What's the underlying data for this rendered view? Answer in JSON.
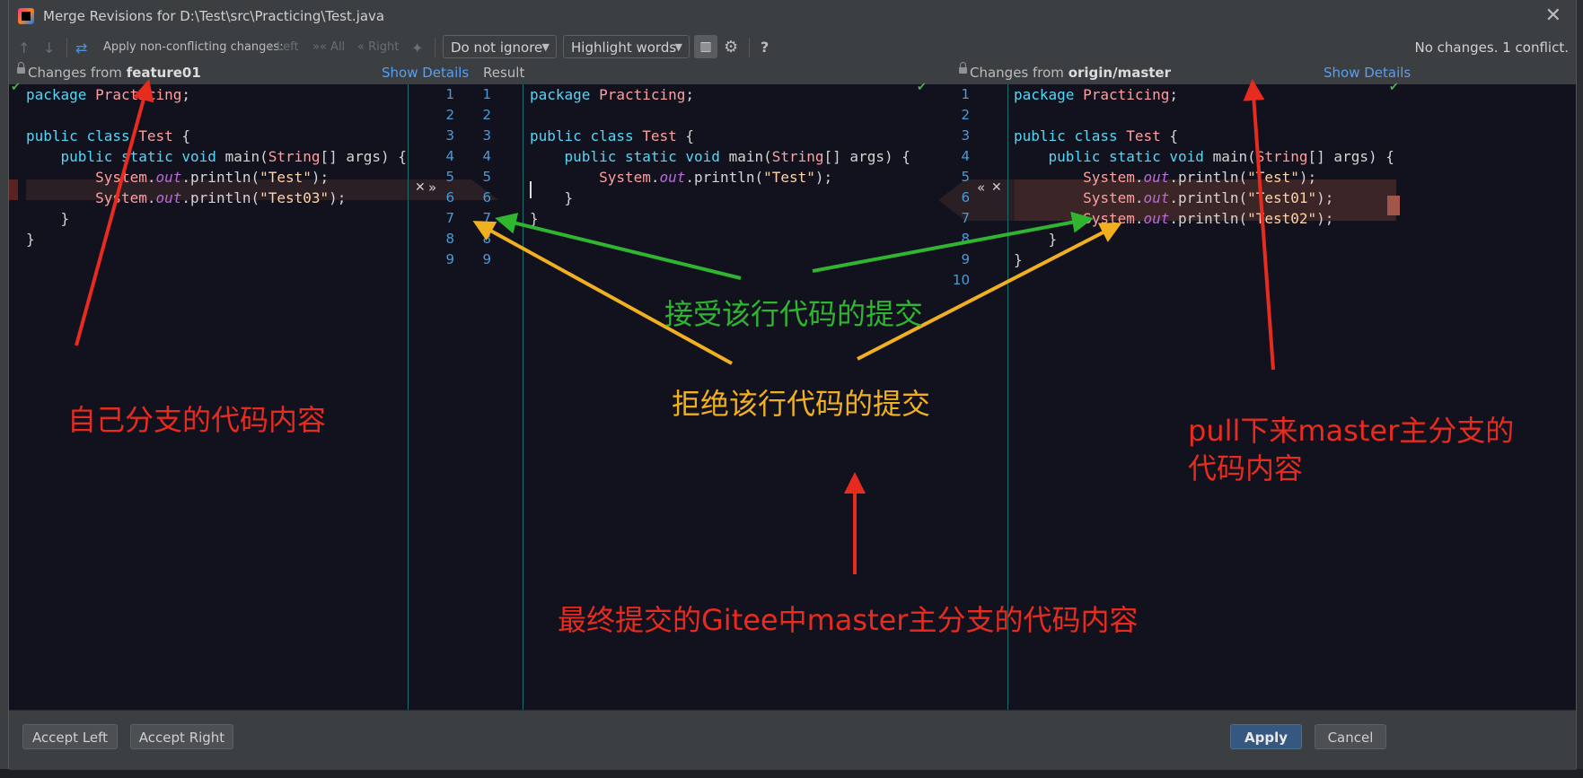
{
  "window": {
    "title": "Merge Revisions for D:\\Test\\src\\Practicing\\Test.java"
  },
  "toolbar": {
    "apply_label": "Apply non-conflicting changes:",
    "left": "Left",
    "all": "All",
    "right": "Right",
    "ignore_combo": "Do not ignore",
    "highlight_combo": "Highlight words",
    "help": "?",
    "status": "No changes. 1 conflict."
  },
  "header": {
    "left_prefix": "Changes from ",
    "left_branch": "feature01",
    "left_link": "Show Details",
    "result": "Result",
    "right_prefix": "Changes from ",
    "right_branch": "origin/master",
    "right_link": "Show Details"
  },
  "left_code": [
    "package Practicing;",
    "",
    "public class Test {",
    "    public static void main(String[] args) {",
    "        System.out.println(\"Test\");",
    "        System.out.println(\"Test03\");",
    "    }",
    "}",
    ""
  ],
  "result_code": [
    "package Practicing;",
    "",
    "public class Test {",
    "    public static void main(String[] args) {",
    "        System.out.println(\"Test\");",
    "    }",
    "}"
  ],
  "right_code": [
    "package Practicing;",
    "",
    "public class Test {",
    "    public static void main(String[] args) {",
    "        System.out.println(\"Test\");",
    "        System.out.println(\"Test01\");",
    "        System.out.println(\"Test02\");",
    "    }",
    "}",
    ""
  ],
  "gutters": {
    "left_numbers": [
      "1",
      "2",
      "3",
      "4",
      "5",
      "6",
      "7",
      "8",
      "9"
    ],
    "result_numbers": [
      "1",
      "2",
      "3",
      "4",
      "5",
      "6",
      "7",
      "8",
      "9"
    ],
    "right_numbers": [
      "1",
      "2",
      "3",
      "4",
      "5",
      "6",
      "7",
      "8",
      "9",
      "10"
    ]
  },
  "buttons": {
    "accept_left": "Accept Left",
    "accept_right": "Accept Right",
    "apply": "Apply",
    "cancel": "Cancel"
  },
  "annotations": {
    "own_branch": "自己分支的代码内容",
    "accept_line": "接受该行代码的提交",
    "reject_line": "拒绝该行代码的提交",
    "pulled_master_1": "pull下来master主分支的",
    "pulled_master_2": "代码内容",
    "final_commit": "最终提交的Gitee中master主分支的代码内容"
  },
  "colors": {
    "accent": "#365880",
    "link": "#589df6",
    "annotation_red": "#e82b1f",
    "annotation_green": "#2fb52f",
    "annotation_yellow": "#f0b020"
  }
}
